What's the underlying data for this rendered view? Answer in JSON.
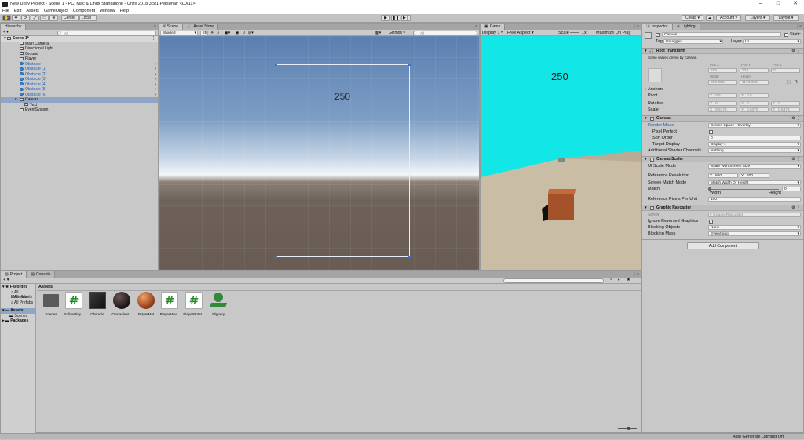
{
  "window": {
    "title": "New Unity Project - Scene 1 - PC, Mac & Linux Standalone - Unity 2018.3.5f1 Personal* <DX11>"
  },
  "menu": [
    "File",
    "Edit",
    "Assets",
    "GameObject",
    "Component",
    "Window",
    "Help"
  ],
  "toolbar": {
    "center": "Center",
    "local": "Local",
    "collab": "Collab ▾",
    "account": "Account ▾",
    "layers": "Layers ▾",
    "layout": "Layout ▾"
  },
  "hierarchy": {
    "tab": "Hierarchy",
    "create": "+ ▾",
    "search_placeholder": "All",
    "scene": "Scene 1*",
    "items": [
      {
        "label": "Main Camera",
        "prefab": false
      },
      {
        "label": "Directional Light",
        "prefab": false
      },
      {
        "label": "Ground",
        "prefab": false
      },
      {
        "label": "Player",
        "prefab": false
      },
      {
        "label": "Obstacle",
        "prefab": true
      },
      {
        "label": "Obstacle (1)",
        "prefab": true
      },
      {
        "label": "Obstacle (2)",
        "prefab": true
      },
      {
        "label": "Obstacle (3)",
        "prefab": true
      },
      {
        "label": "Obstacle (4)",
        "prefab": true
      },
      {
        "label": "Obstacle (5)",
        "prefab": true
      },
      {
        "label": "Obstacle (6)",
        "prefab": true
      },
      {
        "label": "Canvas",
        "prefab": false
      },
      {
        "label": "Text",
        "prefab": false
      },
      {
        "label": "EventSystem",
        "prefab": false
      }
    ]
  },
  "scene": {
    "tab_scene": "Scene",
    "tab_asset_store": "Asset Store",
    "shading": "Shaded",
    "mode_2d": "2D",
    "gizmo_count": "0",
    "gizmos": "Gizmos ▾",
    "search_placeholder": "All",
    "score": "250"
  },
  "game": {
    "tab": "Game",
    "display": "Display 1",
    "aspect": "Free Aspect",
    "scale_label": "Scale",
    "scale_value": "1x",
    "maximize": "Maximize On Play",
    "score": "250"
  },
  "inspector": {
    "tab": "Inspector",
    "tab_lighting": "Lighting",
    "object_name": "Canvas",
    "static_label": "Static",
    "tag_label": "Tag",
    "tag_value": "Untagged",
    "layer_label": "Layer",
    "layer_value": "UI",
    "rect_title": "Rect Transform",
    "rect_note": "Some values driven by Canvas.",
    "pos_x_label": "Pos X",
    "pos_y_label": "Pos Y",
    "pos_z_label": "Pos Z",
    "pos_x": "255",
    "pos_y": "374",
    "pos_z": "0",
    "width_label": "Width",
    "height_label": "Height",
    "width": "800.0001",
    "height": "1173.333",
    "anchors": "Anchors",
    "pivot": "Pivot",
    "pivot_x": "0.5",
    "pivot_y": "0.5",
    "rotation": "Rotation",
    "rot_x": "0",
    "rot_y": "0",
    "rot_z": "0",
    "scale": "Scale",
    "scale_x": "0.6375",
    "scale_y": "0.6375",
    "scale_z": "0.6375",
    "canvas_title": "Canvas",
    "render_mode_label": "Render Mode",
    "render_mode": "Screen Space - Overlay",
    "pixel_perfect": "Pixel Perfect",
    "sort_order_label": "Sort Order",
    "sort_order": "0",
    "target_display_label": "Target Display",
    "target_display": "Display 1",
    "shader_channels_label": "Additional Shader Channels",
    "shader_channels": "Nothing",
    "scaler_title": "Canvas Scaler",
    "ui_scale_label": "UI Scale Mode",
    "ui_scale": "Scale With Screen Size",
    "ref_res_label": "Reference Resolution",
    "ref_x": "800",
    "ref_y": "600",
    "match_mode_label": "Screen Match Mode",
    "match_mode": "Match Width Or Height",
    "match_label": "Match",
    "match_value": "0",
    "match_width": "Width",
    "match_height": "Height",
    "ref_ppu_label": "Reference Pixels Per Unit",
    "ref_ppu": "100",
    "raycaster_title": "Graphic Raycaster",
    "script_label": "Script",
    "script_value": "GraphicRaycaster",
    "ignore_reversed": "Ignore Reversed Graphics",
    "blocking_objects_label": "Blocking Objects",
    "blocking_objects": "None",
    "blocking_mask_label": "Blocking Mask",
    "blocking_mask": "Everything",
    "add_component": "Add Component"
  },
  "project": {
    "tab_project": "Project",
    "tab_console": "Console",
    "create": "+ ▾",
    "favorites": "Favorites",
    "fav_items": [
      "All Materials",
      "All Models",
      "All Prefabs"
    ],
    "assets": "Assets",
    "asset_folders": [
      "Scenes",
      "Packages"
    ],
    "breadcrumb": "Assets",
    "items": [
      {
        "label": "Scenes",
        "kind": "folder"
      },
      {
        "label": "FollowPlay...",
        "kind": "script"
      },
      {
        "label": "Obstacle",
        "kind": "cube"
      },
      {
        "label": "ObstacleM...",
        "kind": "sphere-dark"
      },
      {
        "label": "PlayerMat",
        "kind": "sphere-orange"
      },
      {
        "label": "PlayerMov...",
        "kind": "script"
      },
      {
        "label": "PlayerRotat...",
        "kind": "script"
      },
      {
        "label": "Slippery",
        "kind": "physic"
      }
    ]
  },
  "statusbar": {
    "text": "Auto Generate Lighting Off"
  },
  "colors": {
    "sky_top": "#5a7fb0",
    "horizon": "#f3f7fb",
    "ground": "#6e625a",
    "game_sky": "#12e6e6",
    "game_ground": "#c9bda5",
    "cube": "#a4522a"
  }
}
